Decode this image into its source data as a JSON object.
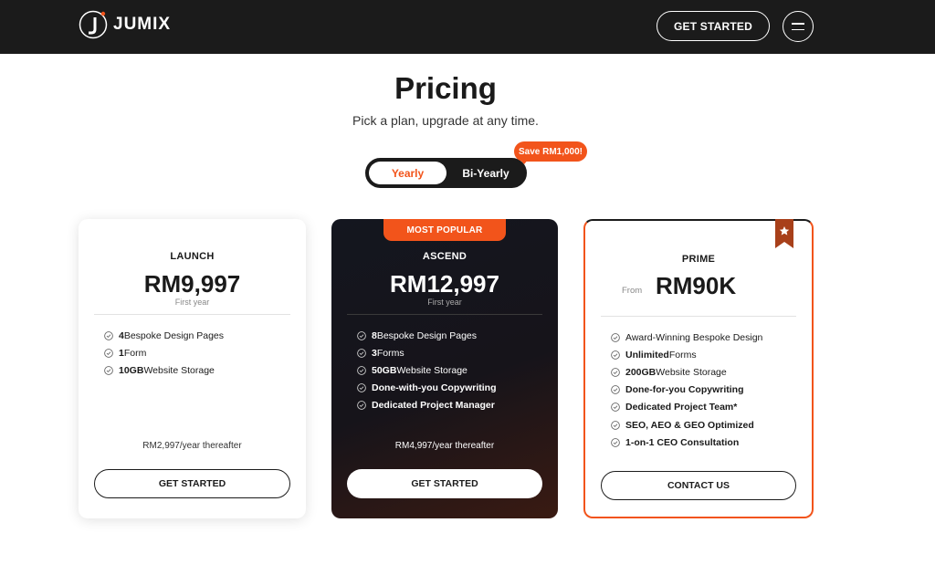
{
  "header": {
    "brand": "JUMIX",
    "cta_label": "GET STARTED"
  },
  "hero": {
    "title": "Pricing",
    "subtitle": "Pick a plan, upgrade at any time."
  },
  "billing_toggle": {
    "options": [
      "Yearly",
      "Bi-Yearly"
    ],
    "selected": "Yearly",
    "save_badge": "Save RM1,000!"
  },
  "plans": [
    {
      "name": "LAUNCH",
      "price": "RM9,997",
      "note": "First year",
      "features": [
        {
          "bold": "4",
          "text": " Bespoke Design Pages"
        },
        {
          "bold": "1",
          "text": " Form"
        },
        {
          "bold": "10GB",
          "text": " Website Storage"
        }
      ],
      "thereafter": "RM2,997/year thereafter",
      "button": "GET STARTED"
    },
    {
      "badge": "MOST POPULAR",
      "name": "ASCEND",
      "price": "RM12,997",
      "note": "First year",
      "features": [
        {
          "bold": "8",
          "text": " Bespoke Design Pages"
        },
        {
          "bold": "3",
          "text": " Forms"
        },
        {
          "bold": "50GB",
          "text": " Website Storage"
        },
        {
          "bold": "Done-with-you Copywriting",
          "text": ""
        },
        {
          "bold": "Dedicated Project Manager",
          "text": ""
        }
      ],
      "thereafter": "RM4,997/year thereafter",
      "button": "GET STARTED"
    },
    {
      "name": "PRIME",
      "price_prefix": "From",
      "price": "RM90K",
      "features": [
        {
          "bold": "",
          "text": "Award-Winning Bespoke Design"
        },
        {
          "bold": "Unlimited",
          "text": " Forms"
        },
        {
          "bold": "200GB",
          "text": " Website Storage"
        },
        {
          "bold": "Done-for-you Copywriting",
          "text": ""
        },
        {
          "bold": "Dedicated Project Team*",
          "text": ""
        },
        {
          "bold": "SEO, AEO & GEO Optimized",
          "text": ""
        },
        {
          "bold": "1-on-1 CEO Consultation",
          "text": ""
        }
      ],
      "button": "CONTACT US"
    }
  ],
  "colors": {
    "accent": "#f2541b",
    "dark": "#1b1b1b"
  }
}
